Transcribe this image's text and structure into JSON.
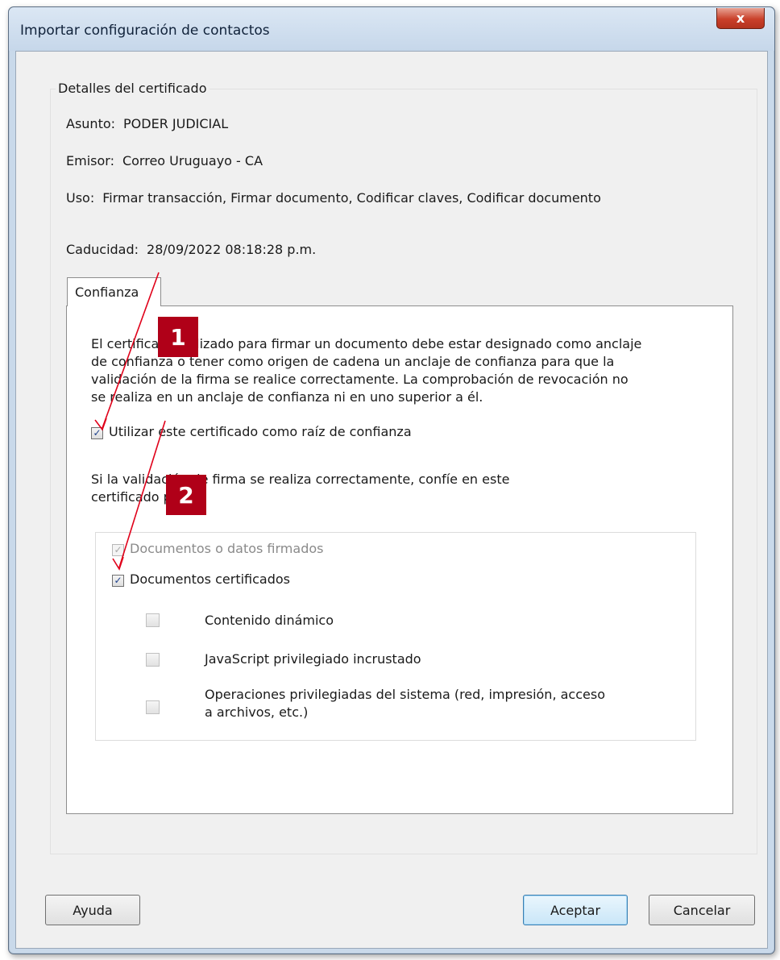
{
  "window": {
    "title": "Importar configuración de contactos",
    "close_label": "x"
  },
  "details": {
    "heading": "Detalles del certificado",
    "subject_label": "Asunto:",
    "subject_value": "PODER JUDICIAL",
    "issuer_label": "Emisor:",
    "issuer_value": "Correo Uruguayo - CA",
    "usage_label": "Uso:",
    "usage_value": "Firmar transacción, Firmar documento, Codificar claves, Codificar documento",
    "expiry_label": "Caducidad:",
    "expiry_value": "28/09/2022 08:18:28 p.m."
  },
  "tab": {
    "label": "Confianza"
  },
  "trust": {
    "paragraph_lines": [
      "El certificado utilizado para firmar un documento debe estar designado como anclaje",
      "de confianza o tener como origen de cadena un anclaje de confianza para que la",
      "validación de la firma se realice correctamente. La comprobación de revocación no",
      "se realiza en un anclaje de confianza ni en uno superior a él."
    ],
    "root_checkbox_label": "Utilizar este certificado como raíz de confianza",
    "root_checked": true,
    "trust_intro_lines": [
      "Si la validación de firma se realiza correctamente, confíe en este",
      "certificado para:"
    ],
    "options": {
      "signed_docs": {
        "label": "Documentos o datos firmados",
        "checked": true,
        "disabled": true
      },
      "certified_docs": {
        "label": "Documentos certificados",
        "checked": true,
        "disabled": false
      },
      "dynamic_content": {
        "label": "Contenido dinámico",
        "checked": false
      },
      "privileged_js": {
        "label": "JavaScript privilegiado incrustado",
        "checked": false
      },
      "privileged_ops_line1": "Operaciones privilegiadas del sistema (red, impresión, acceso",
      "privileged_ops_line2": "a archivos, etc.)",
      "privileged_ops_checked": false
    }
  },
  "annotations": {
    "badge1": "1",
    "badge2": "2",
    "badge_color": "#b00018",
    "arrow_color": "#e0001a"
  },
  "buttons": {
    "help": "Ayuda",
    "accept": "Aceptar",
    "cancel": "Cancelar"
  }
}
